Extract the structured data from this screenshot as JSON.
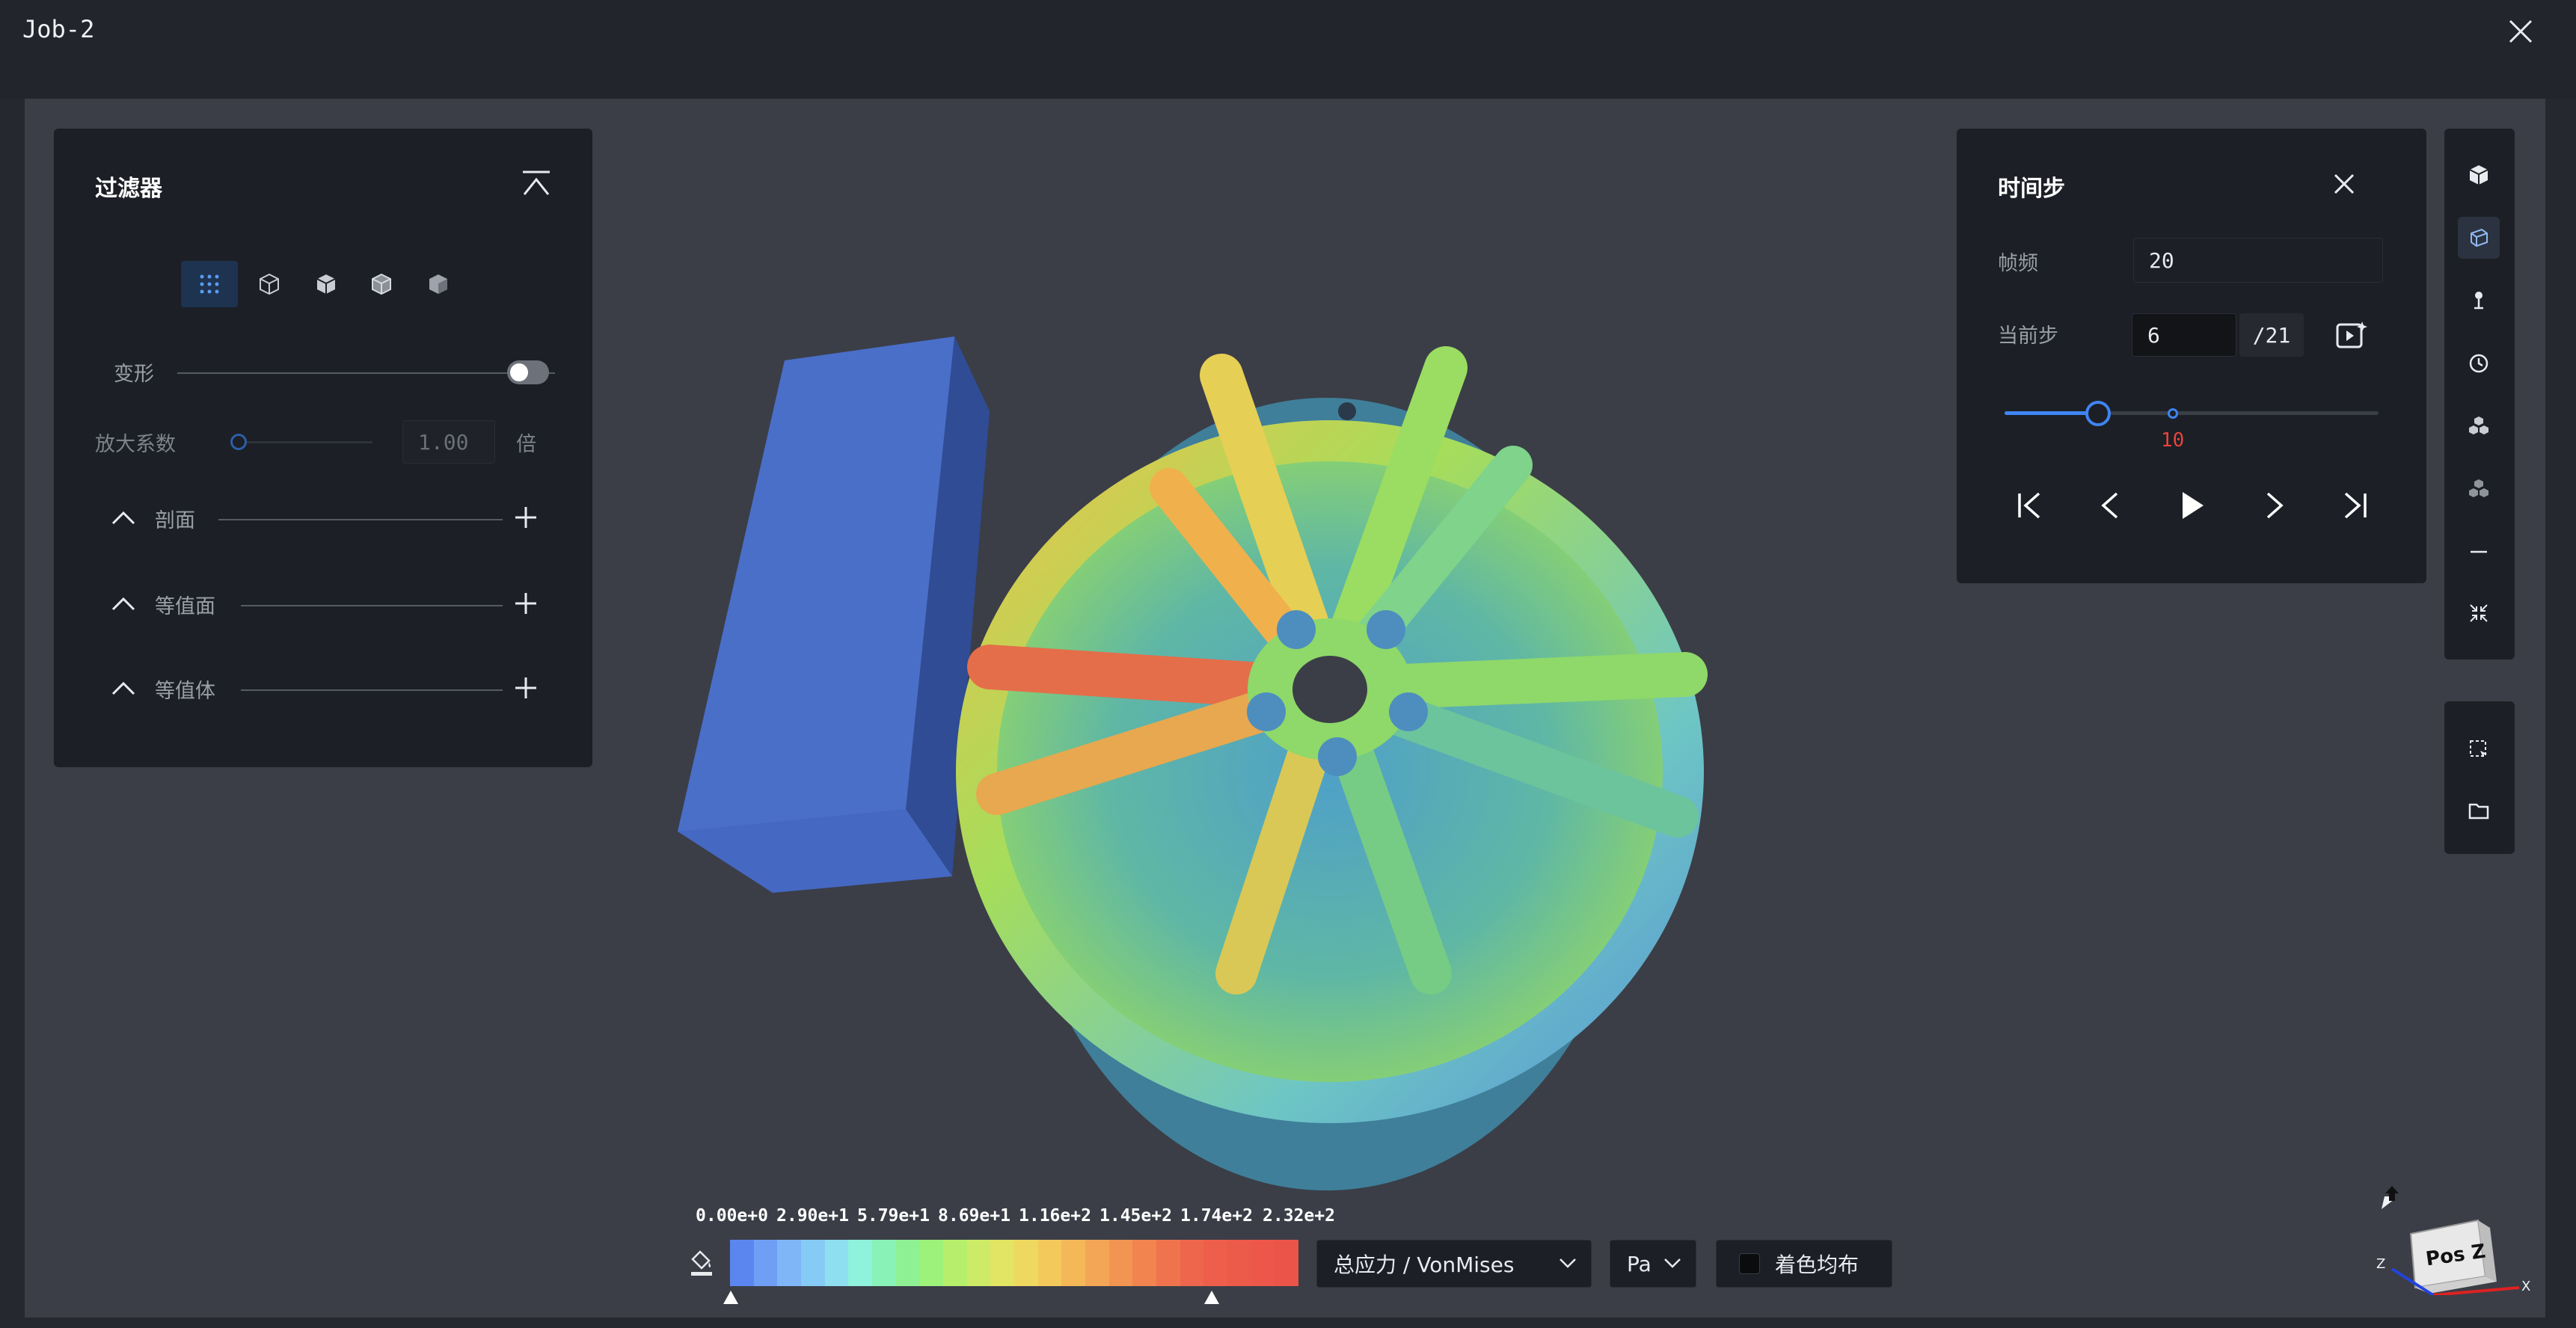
{
  "window": {
    "title": "Job-2"
  },
  "filter_panel": {
    "title": "过滤器",
    "deform_label": "变形",
    "scale_label": "放大系数",
    "scale_value": "1.00",
    "scale_unit": "倍",
    "sections": [
      {
        "label": "剖面"
      },
      {
        "label": "等值面"
      },
      {
        "label": "等值体"
      }
    ]
  },
  "timestep_panel": {
    "title": "时间步",
    "fps_label": "帧频",
    "fps_value": "20",
    "current_label": "当前步",
    "current_value": "6",
    "total": "/21",
    "marker_value": "10",
    "progress": 0.25,
    "marker_progress": 0.45
  },
  "legend": {
    "values": [
      "0.00e+0",
      "2.90e+1",
      "5.79e+1",
      "8.69e+1",
      "1.16e+2",
      "1.45e+2",
      "1.74e+2",
      "2.32e+2"
    ],
    "colors": [
      "#5b86f0",
      "#6f9ff4",
      "#7fb6f7",
      "#86cbf6",
      "#8ee0f0",
      "#8ef2dc",
      "#88f2b7",
      "#8ef295",
      "#9df27a",
      "#b6ef6c",
      "#cdeb66",
      "#e2e463",
      "#efd860",
      "#f4c95c",
      "#f4b858",
      "#f3a655",
      "#f29452",
      "#f1844f",
      "#ef744d",
      "#ee664b",
      "#ed5f4a",
      "#ec5a49",
      "#ec5749",
      "#eb5449"
    ],
    "quantity": "总应力 / VonMises",
    "unit": "Pa",
    "uniform_label": "着色均布"
  },
  "view_cube": {
    "face_label": "Pos Z",
    "axis_z": "Z",
    "axis_x": "X"
  },
  "colors": {
    "accent": "#3f84f2",
    "marker": "#e8433c"
  }
}
